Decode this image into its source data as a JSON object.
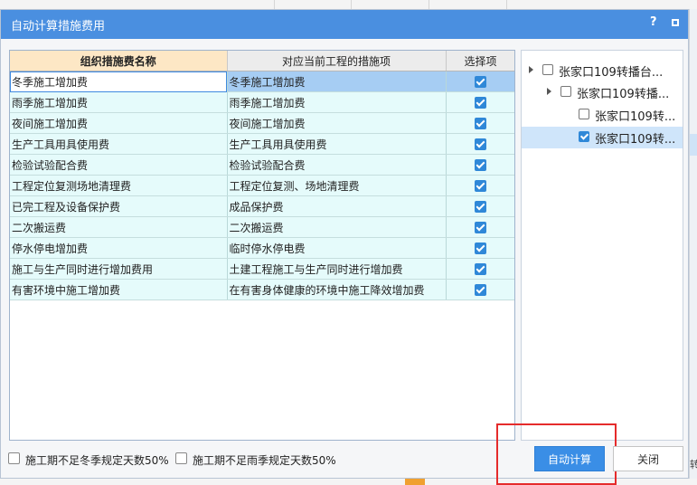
{
  "dialog": {
    "title": "自动计算措施费用",
    "help": "?"
  },
  "grid": {
    "headers": {
      "name": "组织措施费名称",
      "measure": "对应当前工程的措施项",
      "select": "选择项"
    },
    "rows": [
      {
        "name": "冬季施工增加费",
        "measure": "冬季施工增加费",
        "checked": true
      },
      {
        "name": "雨季施工增加费",
        "measure": "雨季施工增加费",
        "checked": true
      },
      {
        "name": "夜间施工增加费",
        "measure": "夜间施工增加费",
        "checked": true
      },
      {
        "name": "生产工具用具使用费",
        "measure": "生产工具用具使用费",
        "checked": true
      },
      {
        "name": "检验试验配合费",
        "measure": "检验试验配合费",
        "checked": true
      },
      {
        "name": "工程定位复测场地清理费",
        "measure": "工程定位复测、场地清理费",
        "checked": true
      },
      {
        "name": "已完工程及设备保护费",
        "measure": "成品保护费",
        "checked": true
      },
      {
        "name": "二次搬运费",
        "measure": "二次搬运费",
        "checked": true
      },
      {
        "name": "停水停电增加费",
        "measure": "临时停水停电费",
        "checked": true
      },
      {
        "name": "施工与生产同时进行增加费用",
        "measure": "土建工程施工与生产同时进行增加费",
        "checked": true
      },
      {
        "name": "有害环境中施工增加费",
        "measure": "在有害身体健康的环境中施工降效增加费",
        "checked": true
      }
    ]
  },
  "tree": {
    "nodes": [
      {
        "label": "张家口109转播台...",
        "checked": false
      },
      {
        "label": "张家口109转播...",
        "checked": false
      },
      {
        "label": "张家口109转...",
        "checked": false
      },
      {
        "label": "张家口109转...",
        "checked": true
      }
    ]
  },
  "footer": {
    "winter_option": "施工期不足冬季规定天数50%",
    "rain_option": "施工期不足雨季规定天数50%",
    "auto_calc_label": "自动计算",
    "close_label": "关闭"
  },
  "background": {
    "right_edge_text": "转"
  },
  "colors": {
    "titlebar": "#4a8fe0",
    "checkbox": "#2f88d8",
    "row_background": "#e5fbfb",
    "highlight_box": "#e52b2b"
  }
}
